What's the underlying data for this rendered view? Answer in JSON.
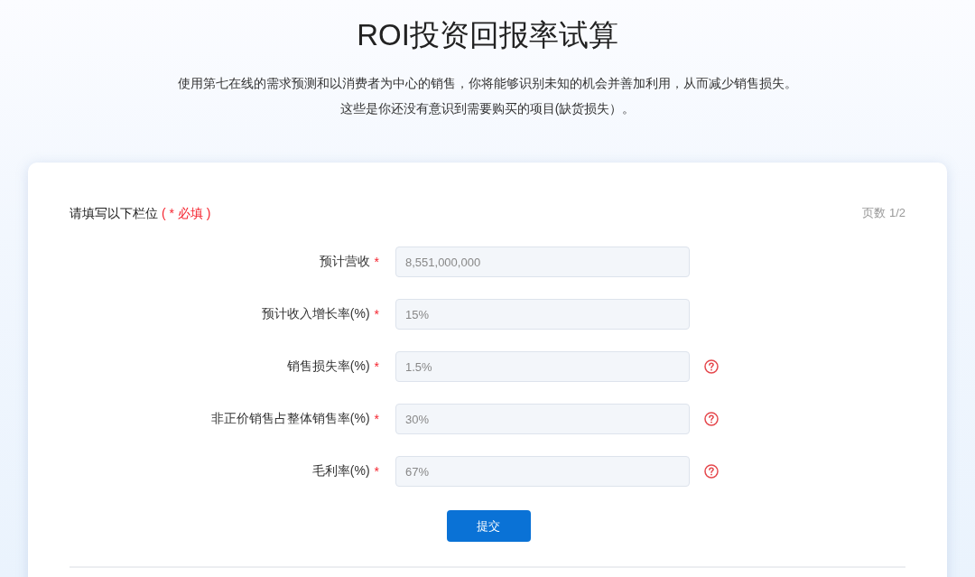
{
  "page": {
    "title": "ROI投资回报率试算",
    "intro": [
      "使用第七在线的需求预测和以消费者为中心的销售，你将能够识别未知的机会并善加利用，从而减少销售损失。",
      "这些是你还没有意识到需要购买的项目(缺货损失）。"
    ]
  },
  "form": {
    "heading": "请填写以下栏位",
    "required_note": "( * 必填 )",
    "page_indicator": "页数 1/2",
    "fields": [
      {
        "label": "预计营收",
        "required_mark": "*",
        "value": "8,551,000,000",
        "help": false
      },
      {
        "label": "预计收入增长率(%)",
        "required_mark": "*",
        "value": "15%",
        "help": false
      },
      {
        "label": "销售损失率(%)",
        "required_mark": "*",
        "value": "1.5%",
        "help": true
      },
      {
        "label": "非正价销售占整体销售率(%)",
        "required_mark": "*",
        "value": "30%",
        "help": true
      },
      {
        "label": "毛利率(%)",
        "required_mark": "*",
        "value": "67%",
        "help": true
      }
    ],
    "submit": "提交"
  }
}
